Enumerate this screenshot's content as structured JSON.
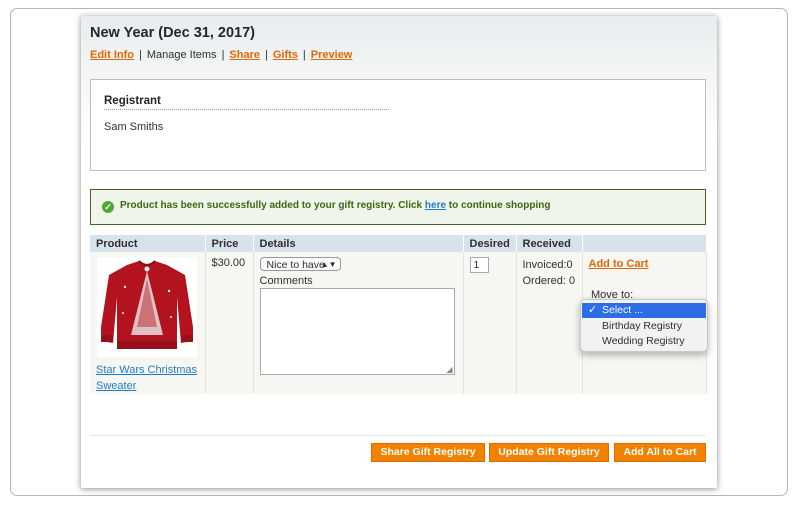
{
  "page": {
    "title": "New Year (Dec 31, 2017)"
  },
  "nav": {
    "edit_info": "Edit Info",
    "manage_items": "Manage Items",
    "share": "Share",
    "gifts": "Gifts",
    "preview": "Preview",
    "separator": "|"
  },
  "registrant": {
    "heading": "Registrant",
    "name": "Sam Smiths"
  },
  "message": {
    "before_link": "Product has been successfully added to your gift registry. Click ",
    "link": "here",
    "after_link": " to continue shopping",
    "icon": "check-circle-icon",
    "color": "#3d6611"
  },
  "table": {
    "headers": {
      "product": "Product",
      "price": "Price",
      "details": "Details",
      "desired": "Desired",
      "received": "Received",
      "actions": ""
    },
    "rows": [
      {
        "product_name": "Star Wars Christmas Sweater",
        "image_icon": "red-christmas-sweater-image",
        "price": "$30.00",
        "priority": "Nice to have",
        "comments_label": "Comments",
        "comments": "",
        "desired_qty": "1",
        "invoiced": "Invoiced:0",
        "ordered": "Ordered: 0",
        "add_to_cart": "Add to Cart",
        "move_to_label": "Move to:"
      }
    ]
  },
  "move_dropdown": {
    "options": [
      "Select ...",
      "Birthday Registry",
      "Wedding Registry"
    ],
    "selected": "Select ..."
  },
  "buttons": {
    "share": "Share Gift Registry",
    "update": "Update Gift Registry",
    "add_all": "Add All to Cart"
  },
  "colors": {
    "link_orange": "#e26703",
    "button_orange": "#f18200",
    "link_blue": "#1e7ec8",
    "table_header": "#d8e2eb",
    "selection_blue": "#2d6ee6"
  }
}
